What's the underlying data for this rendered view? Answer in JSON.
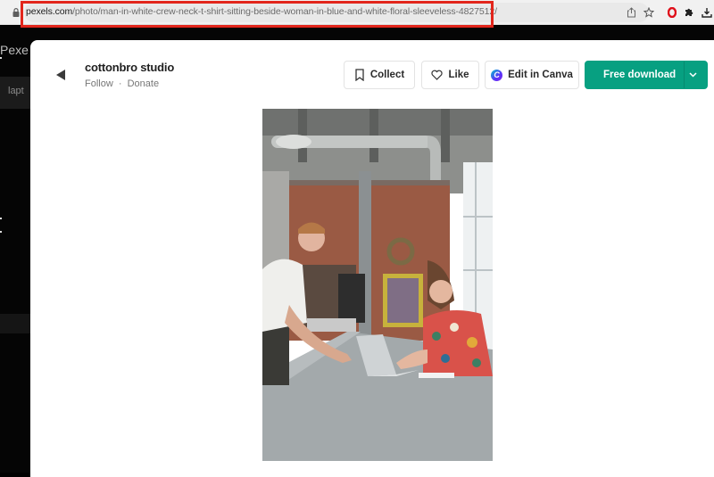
{
  "browser": {
    "url_domain": "pexels.com",
    "url_path": "/photo/man-in-white-crew-neck-t-shirt-sitting-beside-woman-in-blue-and-white-floral-sleeveless-4827512/",
    "icons": [
      "lock-icon",
      "share-icon",
      "bookmark-star-icon",
      "opera-icon",
      "extensions-icon",
      "download-icon"
    ],
    "highlight_color": "#e2261c"
  },
  "background_page": {
    "partial_texts": [
      "Pexe",
      "lapt"
    ]
  },
  "modal": {
    "author": {
      "name": "cottonbro studio",
      "follow_label": "Follow",
      "separator": "·",
      "donate_label": "Donate"
    },
    "actions": {
      "collect_label": "Collect",
      "like_label": "Like",
      "canva_label": "Edit in Canva",
      "download_label": "Free download"
    },
    "accent_color": "#07a081",
    "photo": {
      "alt": "Man in white crew neck t-shirt sitting beside woman in blue and white floral sleeveless"
    }
  }
}
